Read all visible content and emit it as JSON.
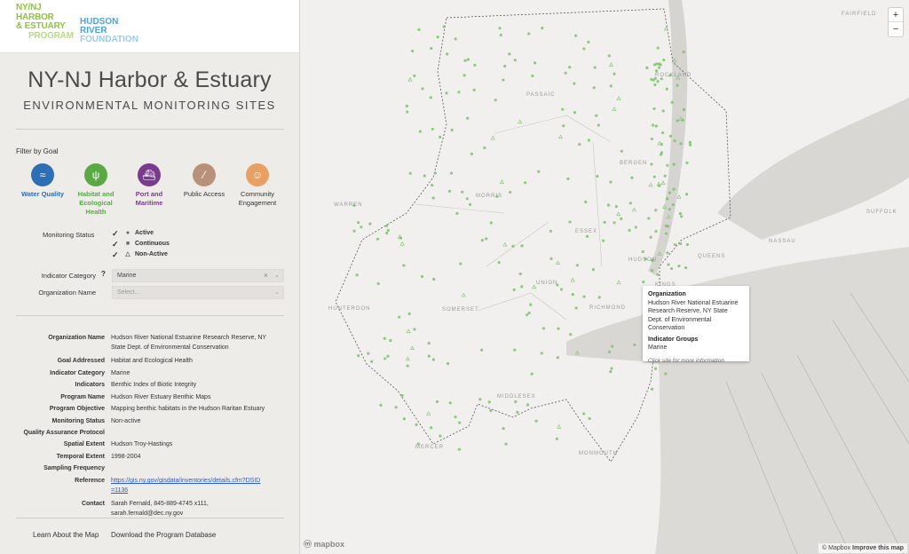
{
  "logos": {
    "program": [
      "NY/NJ",
      "HARBOR",
      "& ESTUARY",
      "PROGRAM"
    ],
    "foundation": [
      "HUDSON",
      "RIVER",
      "FOUNDATION"
    ]
  },
  "title": "NY-NJ Harbor & Estuary",
  "subtitle": "ENVIRONMENTAL MONITORING SITES",
  "filter_label": "Filter by Goal",
  "goals": [
    {
      "label": "Water Quality",
      "color": "#2e6eb5",
      "icon": "waves-icon"
    },
    {
      "label": "Habitat and Ecological Health",
      "color": "#5aa945",
      "icon": "grass-icon"
    },
    {
      "label": "Port and Maritime",
      "color": "#7a3b8f",
      "icon": "ship-icon"
    },
    {
      "label": "Public Access",
      "color": "#b9917a",
      "icon": "kayak-icon"
    },
    {
      "label": "Community Engagement",
      "color": "#e8a063",
      "icon": "people-icon"
    }
  ],
  "monitoring_status": {
    "label": "Monitoring Status",
    "items": [
      {
        "label": "Active",
        "symbol": "●"
      },
      {
        "label": "Continuous",
        "symbol": "■"
      },
      {
        "label": "Non-Active",
        "symbol": "△"
      }
    ]
  },
  "indicator_category": {
    "label": "Indicator Category",
    "help": "?",
    "value": "Marine"
  },
  "organization_name": {
    "label": "Organization Name",
    "placeholder": "Select..."
  },
  "details": [
    {
      "label": "Organization Name",
      "value": "Hudson River National Estuarine Research Reserve, NY State Dept. of Environmental Conservation"
    },
    {
      "label": "Goal Addressed",
      "value": "Habitat and Ecological Health"
    },
    {
      "label": "Indicator Category",
      "value": "Marine"
    },
    {
      "label": "Indicators",
      "value": "Benthic Index of Biotic Integrity"
    },
    {
      "label": "Program Name",
      "value": "Hudson River Estuary Benthic Maps"
    },
    {
      "label": "Program Objective",
      "value": "Mapping benthic habitats in the Hudson Raritan Estuary"
    },
    {
      "label": "Monitoring Status",
      "value": "Non-active"
    },
    {
      "label": "Quality Assurance Protocol",
      "value": ""
    },
    {
      "label": "Spatial Extent",
      "value": "Hudson Troy-Hastings"
    },
    {
      "label": "Temporal Extent",
      "value": "1998-2004"
    },
    {
      "label": "Sampling Frequency",
      "value": ""
    },
    {
      "label": "Reference",
      "value": "https://gis.ny.gov/gisdata/inventories/details.cfm?DSID=1136"
    },
    {
      "label": "Contact",
      "value": "Sarah Fernald, 845-889-4745 x111, sarah.fernald@dec.ny.gov"
    }
  ],
  "footer": {
    "learn": "Learn About the Map",
    "download": "Download the Program Database"
  },
  "map": {
    "labels": [
      "FAIRFIELD",
      "ROCKLAND",
      "PASSAIC",
      "BERGEN",
      "WARREN",
      "MORRIS",
      "ESSEX",
      "SUFFOLK",
      "NASSAU",
      "QUEENS",
      "HUDSON",
      "KINGS",
      "UNION",
      "HUNTERDON",
      "SOMERSET",
      "RICHMOND",
      "MIDDLESEX",
      "MERCER",
      "MONMOUTH"
    ],
    "zoom_in": "+",
    "zoom_out": "−",
    "popup": {
      "org_heading": "Organization",
      "org_value": "Hudson River National Estuarine Research Reserve, NY State Dept. of Environmental Conservation",
      "ind_heading": "Indicator Groups",
      "ind_value": "Marine",
      "hint": "Click site for more information"
    },
    "logo": "mapbox",
    "attribution_1": "© Mapbox",
    "attribution_2": "Improve this map",
    "point_color": "#7ac36a",
    "water_color": "#d3d1cd"
  }
}
